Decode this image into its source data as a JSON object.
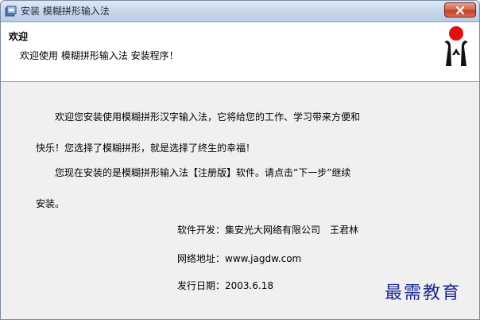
{
  "window": {
    "title": "安装 模糊拼形输入法"
  },
  "header": {
    "title": "欢迎",
    "subtitle": "欢迎使用 模糊拼形输入法 安装程序！"
  },
  "body": {
    "para1_line1": "欢迎您安装使用模糊拼形汉字输入法，它将给您的工作、学习带来方便和",
    "para1_line2": "快乐！您选择了模糊拼形，就是选择了终生的幸福！",
    "para2_line1": "您现在安装的是模糊拼形输入法【注册版】软件。请点击“下一步”继续",
    "para2_line2": "安装。",
    "developer_line": "软件开发：集安光大网络有限公司　王君林",
    "website_line": "网络地址：www.jagdw.com",
    "release_line": "发行日期：2003.6.18"
  },
  "watermark": "最需教育",
  "colors": {
    "close_button": "#c0432a",
    "logo_red": "#e01010",
    "logo_black": "#111111",
    "watermark": "#1c2a8f"
  },
  "icons": {
    "app": "installer-icon",
    "close": "close-icon",
    "logo": "brand-logo"
  }
}
